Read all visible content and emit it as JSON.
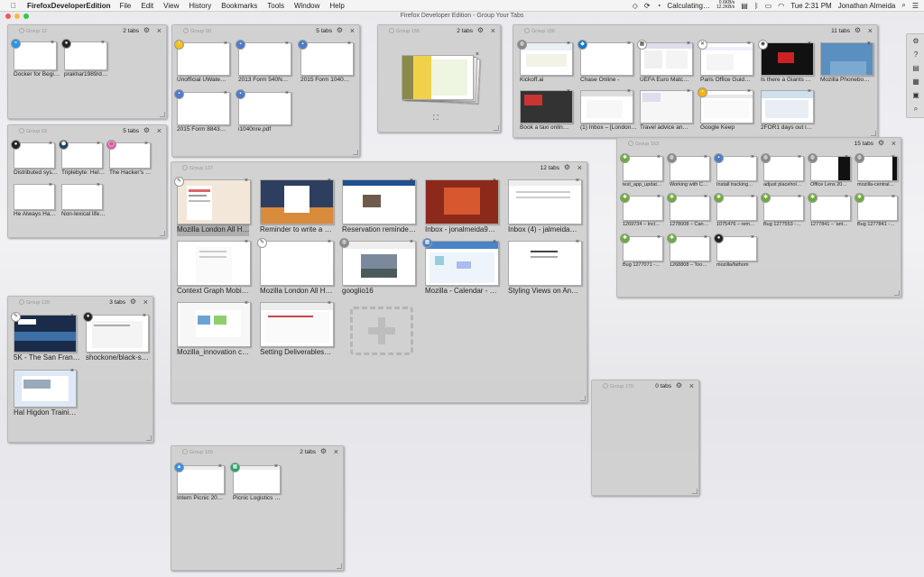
{
  "menubar": {
    "app_name": "FirefoxDeveloperEdition",
    "items": [
      "File",
      "Edit",
      "View",
      "History",
      "Bookmarks",
      "Tools",
      "Window",
      "Help"
    ],
    "status_text": "Calculating…",
    "net_up": "0.6KB/s",
    "net_down": "12.2KB/s",
    "time": "Tue 2:31 PM",
    "user": "Jonathan Almeida"
  },
  "window": {
    "title": "Firefox Developer Edition - Group Your Tabs"
  },
  "groups": [
    {
      "name": "Group 12",
      "count": "2 tabs",
      "tabs": [
        "Docker for Begi…",
        "prakhar1989/do…"
      ],
      "favicons": [
        "docker",
        "github"
      ]
    },
    {
      "name": "Group 90",
      "count": "5 tabs",
      "tabs": [
        "Unofficial UWate…",
        "2013 Form 540N…",
        "2015 Form 1040…",
        "2015 Form 8843…",
        "i1040nre.pdf"
      ],
      "favicons": [
        "warn",
        "doc",
        "doc",
        "doc",
        "doc"
      ]
    },
    {
      "name": "Group 155",
      "count": "2 tabs",
      "tabs": []
    },
    {
      "name": "Group 156",
      "count": "11 tabs",
      "tabs": [
        "Kickoff.ai",
        "Chase Online -",
        "UEFA Euro Matc…",
        "Paris Office Guid…",
        "Is there a Giants …",
        "Mozilla Phonebo…",
        "Book a taxi onlin…",
        "(1) Inbox – [London…",
        "Travel advice an…",
        "Google Keep",
        "2FOR1 days out i…"
      ],
      "favicons": [
        "globe",
        "chase",
        "uefa",
        "x",
        "ball",
        "",
        "",
        "",
        "",
        "keep",
        ""
      ]
    },
    {
      "name": "Group 63",
      "count": "5 tabs",
      "tabs": [
        "Distributed sys…",
        "Triplebyte: Hel…",
        "The Hacker's …",
        "He Always Had…",
        "Non-lexical life…"
      ],
      "favicons": [
        "github",
        "hex",
        "rainbow",
        "",
        ""
      ]
    },
    {
      "name": "Group 137",
      "count": "12 tabs",
      "tabs": [
        "Mozilla London All H…",
        "Reminder to write a …",
        "Reservation reminde…",
        "Inbox - jonalmeida9…",
        "Inbox (4) - jalmeida…",
        "Context Graph Mobi…",
        "Mozilla London All H…",
        "googlio16",
        "Mozilla - Calendar - …",
        "Styling Views on An…",
        "Mozilla_innovation c…",
        "Setting Deliverables…"
      ],
      "favicons": [
        "pen",
        "",
        "",
        "",
        "",
        "",
        "pen",
        "globe",
        "cal",
        "",
        "",
        ""
      ]
    },
    {
      "name": "Group 163",
      "count": "15 tabs",
      "tabs": [
        "test_app_updat…",
        "Working with C…",
        "Install tracking…",
        "adjust placehol…",
        "Office Lens 20…",
        "mozilla-central…",
        "1269734 – Incl…",
        "1278008 – Can…",
        "1075476 – rem…",
        "Bug 1277553 -…",
        "1277841 – 'ant…",
        "Bug 1277841 -…",
        "Bug 1277071 -…",
        "1268808 – Too…",
        "mozilla/fathom"
      ],
      "favicons": [
        "bug",
        "globe",
        "doc",
        "globe",
        "globe",
        "globe",
        "bug",
        "bug",
        "bug",
        "bug",
        "bug",
        "bug",
        "bug",
        "bug",
        "github"
      ]
    },
    {
      "name": "Group 139",
      "count": "3 tabs",
      "tabs": [
        "5K - The San Fran…",
        "shockone/black-s…",
        "Hal Higdon Traini…"
      ],
      "favicons": [
        "pen",
        "github",
        ""
      ]
    },
    {
      "name": "Group 170",
      "count": "0 tabs",
      "tabs": []
    },
    {
      "name": "Group 159",
      "count": "2 tabs",
      "tabs": [
        "Intern Picnic 20…",
        "Picnic Logistics …"
      ],
      "favicons": [
        "drive",
        "sheets"
      ]
    }
  ],
  "colors": {
    "traffic_red": "#fc5753",
    "traffic_yellow": "#fdbc40",
    "traffic_green": "#33c748",
    "bg": "#ececf0",
    "group_bg": "#cdcdcd"
  },
  "toolbar_icons": [
    "gear-icon",
    "help-icon",
    "list-icon",
    "grid-icon",
    "groups-icon",
    "search-icon"
  ]
}
